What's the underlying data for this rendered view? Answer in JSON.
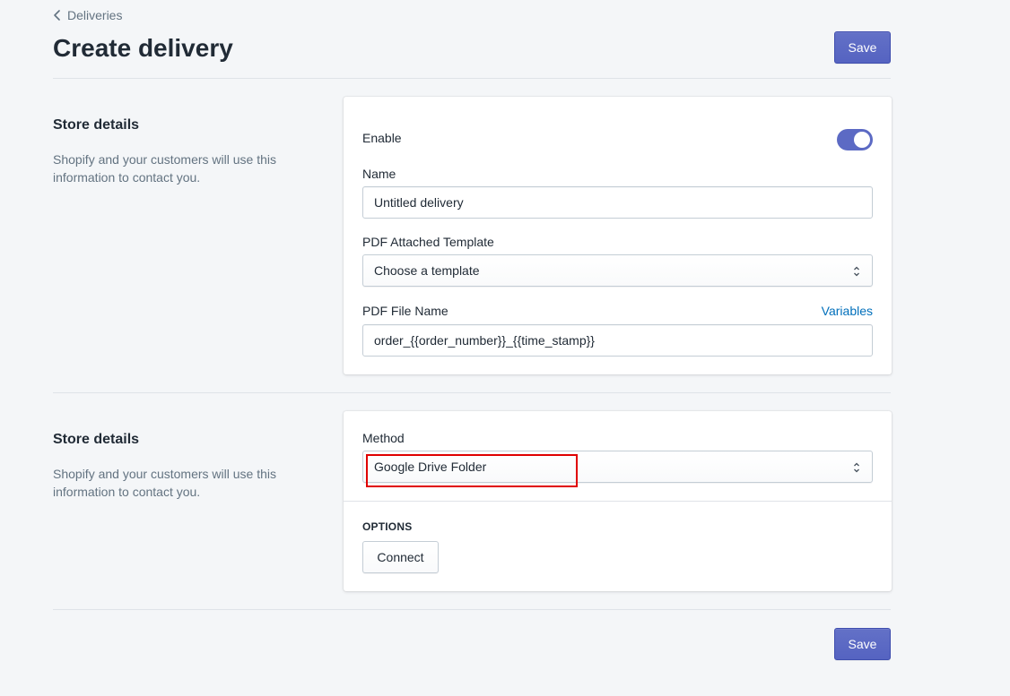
{
  "breadcrumb": {
    "label": "Deliveries",
    "icon": "chevron-left-icon"
  },
  "page": {
    "title": "Create delivery"
  },
  "actions": {
    "save_label": "Save"
  },
  "section1": {
    "title": "Store details",
    "description": "Shopify and your customers will use this information to contact you.",
    "enable_label": "Enable",
    "enabled": true,
    "name_label": "Name",
    "name_value": "Untitled delivery",
    "template_label": "PDF Attached Template",
    "template_value": "Choose a template",
    "filename_label": "PDF File Name",
    "variables_link": "Variables",
    "filename_value": "order_{{order_number}}_{{time_stamp}}"
  },
  "section2": {
    "title": "Store details",
    "description": "Shopify and your customers will use this information to contact you.",
    "method_label": "Method",
    "method_value": "Google Drive Folder",
    "options_label": "OPTIONS",
    "connect_label": "Connect"
  },
  "colors": {
    "primary": "#5c6ac4",
    "link": "#006fbb",
    "highlight": "#e00000",
    "background": "#f4f6f8"
  }
}
